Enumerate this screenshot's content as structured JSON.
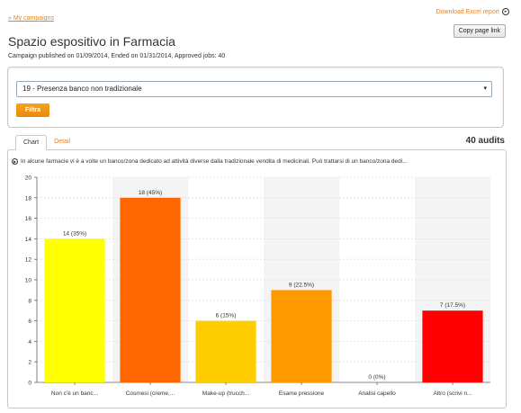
{
  "nav": {
    "back_link": "« My campaigns"
  },
  "actions": {
    "excel_label": "Download Excel report",
    "copy_label": "Copy page link"
  },
  "header": {
    "title": "Spazio espositivo in Farmacia",
    "subtitle": "Campaign published on 01/09/2014, Ended on 01/31/2014, Approved jobs: 40"
  },
  "filter": {
    "selected": "19 - Presenza banco non tradizionale",
    "button_label": "Filtra"
  },
  "tabs": [
    {
      "label": "Chart",
      "active": true
    },
    {
      "label": "Detail",
      "active": false
    }
  ],
  "audits_label": "40 audits",
  "question": "In alcune farmacie vi è a volte un banco/zona dedicato ad attività diverse dalla tradizionale vendita di medicinali. Può trattarsi di un banco/zona dedi...",
  "chart_data": {
    "type": "bar",
    "categories": [
      "Non c'è un banc...",
      "Cosmesi (creme,...",
      "Make-up (trucch...",
      "Esame pressione",
      "Analisi capello",
      "Altro (scrivi n..."
    ],
    "values": [
      14,
      18,
      6,
      9,
      0,
      7
    ],
    "labels": [
      "14 (35%)",
      "18 (45%)",
      "6 (15%)",
      "9 (22.5%)",
      "0 (0%)",
      "7 (17.5%)"
    ],
    "colors": [
      "#ffff00",
      "#ff6600",
      "#ffcc00",
      "#ff9900",
      "#ffffff",
      "#ff0000"
    ],
    "ylim": [
      0,
      20
    ],
    "yticks": [
      0,
      2,
      4,
      6,
      8,
      10,
      12,
      14,
      16,
      18,
      20
    ],
    "grid": true
  }
}
